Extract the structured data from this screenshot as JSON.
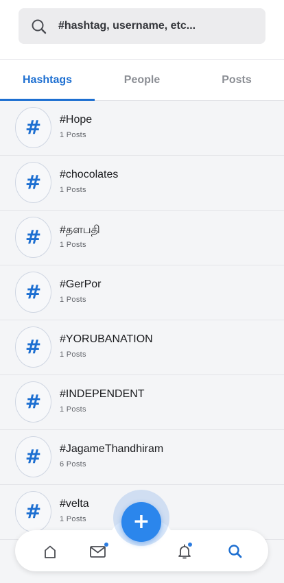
{
  "search": {
    "placeholder": "#hashtag, username, etc..."
  },
  "tabs": [
    {
      "label": "Hashtags",
      "active": true
    },
    {
      "label": "People",
      "active": false
    },
    {
      "label": "Posts",
      "active": false
    }
  ],
  "hashtag_icon": "#",
  "hashtags": [
    {
      "name": "#Hope",
      "count": "1 Posts"
    },
    {
      "name": "#chocolates",
      "count": "1 Posts"
    },
    {
      "name": "#தளபதி",
      "count": "1 Posts"
    },
    {
      "name": "#GerPor",
      "count": "1 Posts"
    },
    {
      "name": "#YORUBANATION",
      "count": "1 Posts"
    },
    {
      "name": "#INDEPENDENT",
      "count": "1 Posts"
    },
    {
      "name": "#JagameThandhiram",
      "count": "6 Posts"
    },
    {
      "name": "#velta",
      "count": "1 Posts"
    }
  ],
  "fab": {
    "label": "+"
  },
  "bottom_nav": [
    {
      "icon": "home-icon",
      "badge": false
    },
    {
      "icon": "mail-icon",
      "badge": true
    },
    {
      "icon": "bell-icon",
      "badge": true
    },
    {
      "icon": "search-icon",
      "badge": false,
      "active": true
    }
  ],
  "colors": {
    "accent": "#1d6fd1",
    "fab": "#2b86ec",
    "badge": "#2b7be0",
    "inactive_tab": "#8b8e94"
  }
}
